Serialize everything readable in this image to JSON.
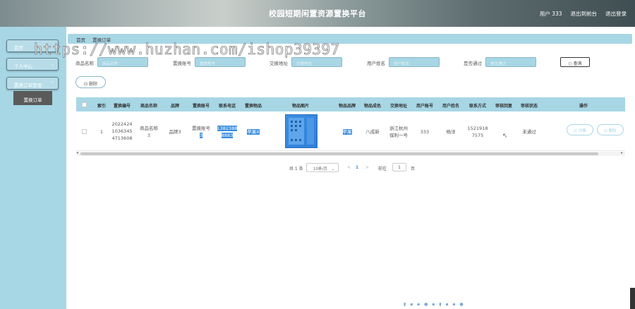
{
  "header": {
    "title": "校园短期闲置资源置换平台",
    "user": "用户 333",
    "backend_link": "退出到前台",
    "logout_link": "退出登录"
  },
  "sidebar": {
    "items": [
      {
        "label": "首页"
      },
      {
        "label": "个人中心"
      },
      {
        "label": "置换订单管理"
      }
    ],
    "subitem": "置换订单"
  },
  "breadcrumb": [
    "首页",
    "置换订单"
  ],
  "search": {
    "fields": [
      {
        "label": "商品名称",
        "placeholder": "商品名称"
      },
      {
        "label": "置换账号",
        "placeholder": "置换账号"
      },
      {
        "label": "交换地址",
        "placeholder": "交换地址"
      },
      {
        "label": "用户姓名",
        "placeholder": "用户姓名"
      },
      {
        "label": "是否通过",
        "placeholder": "是否通过"
      }
    ],
    "query_button": "查询"
  },
  "delete_button": "删除",
  "table": {
    "headers": [
      "索引",
      "置换编号",
      "商品名称",
      "品牌",
      "置换账号",
      "联系电话",
      "置换物品",
      "物品图片",
      "物品品牌",
      "物品成色",
      "交换地址",
      "用户账号",
      "用户姓名",
      "联系方式",
      "审核回复",
      "审核状态",
      "操作"
    ],
    "rows": [
      {
        "index": "1",
        "order_no": "20224241036345471360 8",
        "order_no_lines": [
          "2022424",
          "1036345",
          "4713608"
        ],
        "product": "商品名称3",
        "product_lines": [
          "商品名称",
          "3"
        ],
        "brand": "品牌3",
        "account_lines": [
          "置换账号",
          "3"
        ],
        "phone_lines": [
          "1382388",
          "8883"
        ],
        "item": "苹果X",
        "item_brand": "苹果",
        "condition": "八成新",
        "address_lines": [
          "浙江杭州",
          "保利一号"
        ],
        "user_account": "333",
        "user_name": "杨洋",
        "contact_lines": [
          "1521918",
          "7575"
        ],
        "review_reply": "",
        "review_status": "未通过",
        "detail_button": "详情",
        "delete_button": "删除"
      }
    ]
  },
  "pagination": {
    "total": "共 1 条",
    "page_size": "10条/页",
    "prev": "<",
    "current": "1",
    "next": ">",
    "goto_label": "前往",
    "goto_value": "1",
    "page_suffix": "页"
  },
  "watermark": "https://www.huzhan.com/ishop39397",
  "colors": {
    "accent": "#a7d6e5",
    "highlight": "#3d8fe0",
    "sub_nav": "#5a5a5a"
  }
}
